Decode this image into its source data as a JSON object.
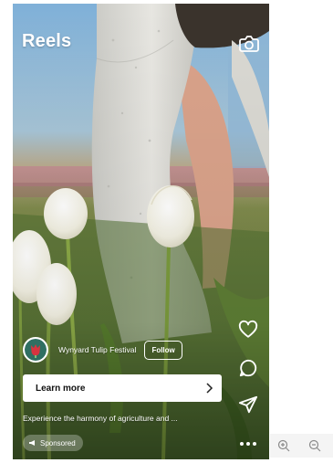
{
  "header": {
    "title": "Reels",
    "camera_icon": "camera-icon"
  },
  "post": {
    "author_name": "Wynyard Tulip Festival",
    "follow_label": "Follow",
    "cta_label": "Learn more",
    "caption": "Experience the harmony of agriculture and ...",
    "sponsored_label": "Sponsored"
  },
  "actions": {
    "like_icon": "heart-icon",
    "comment_icon": "comment-icon",
    "share_icon": "send-icon",
    "more_icon": "more-dots-icon"
  },
  "zoom_controls": [
    "zoom-in-icon",
    "zoom-out-icon"
  ],
  "colors": {
    "overlay_text": "#ffffff",
    "cta_background": "#ffffff",
    "avatar_accent": "#d6343f"
  }
}
